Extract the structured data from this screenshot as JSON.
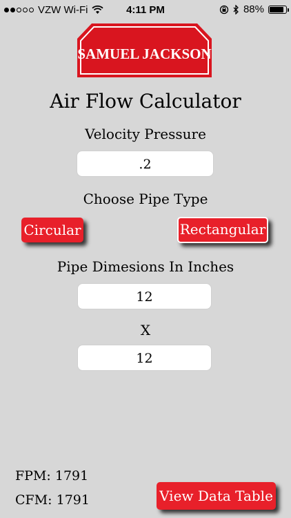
{
  "status_bar": {
    "carrier": "VZW Wi-Fi",
    "time": "4:11 PM",
    "battery": "88%",
    "battery_level": 0.88
  },
  "logo": {
    "text": "SAMUEL JACKSON",
    "color": "#e8202a"
  },
  "title": "Air Flow Calculator",
  "velocity": {
    "label": "Velocity Pressure",
    "value": ".2"
  },
  "pipe_type": {
    "label": "Choose Pipe Type",
    "circular": "Circular",
    "rectangular": "Rectangular",
    "selected": "rectangular"
  },
  "dimensions": {
    "label": "Pipe Dimesions In Inches",
    "width": "12",
    "separator": "X",
    "height": "12"
  },
  "results": {
    "fpm": "FPM: 1791",
    "cfm": "CFM: 1791"
  },
  "view_table_label": "View Data Table",
  "colors": {
    "accent": "#e8202a",
    "background": "#d7d7d7"
  }
}
